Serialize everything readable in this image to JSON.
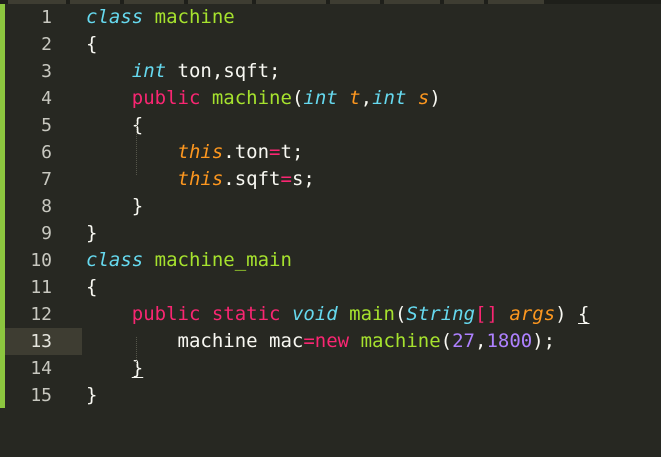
{
  "editor": {
    "lines": [
      {
        "num": "1",
        "tokens": [
          {
            "t": "class",
            "c": "st"
          },
          {
            "t": " "
          },
          {
            "t": "machine",
            "c": "fn"
          }
        ]
      },
      {
        "num": "2",
        "tokens": [
          {
            "t": "{"
          }
        ]
      },
      {
        "num": "3",
        "tokens": [
          {
            "t": "    "
          },
          {
            "t": "int",
            "c": "st"
          },
          {
            "t": " ton,sqft;"
          }
        ]
      },
      {
        "num": "4",
        "tokens": [
          {
            "t": "    "
          },
          {
            "t": "public",
            "c": "kw"
          },
          {
            "t": " "
          },
          {
            "t": "machine",
            "c": "fn"
          },
          {
            "t": "("
          },
          {
            "t": "int",
            "c": "st"
          },
          {
            "t": " "
          },
          {
            "t": "t",
            "c": "ar"
          },
          {
            "t": ","
          },
          {
            "t": "int",
            "c": "st"
          },
          {
            "t": " "
          },
          {
            "t": "s",
            "c": "ar"
          },
          {
            "t": ")"
          }
        ]
      },
      {
        "num": "5",
        "tokens": [
          {
            "t": "    {"
          }
        ]
      },
      {
        "num": "6",
        "tokens": [
          {
            "t": "        "
          },
          {
            "t": "this",
            "c": "ar"
          },
          {
            "t": ".ton"
          },
          {
            "t": "=",
            "c": "kw"
          },
          {
            "t": "t;"
          }
        ]
      },
      {
        "num": "7",
        "tokens": [
          {
            "t": "        "
          },
          {
            "t": "this",
            "c": "ar"
          },
          {
            "t": ".sqft"
          },
          {
            "t": "=",
            "c": "kw"
          },
          {
            "t": "s;"
          }
        ]
      },
      {
        "num": "8",
        "tokens": [
          {
            "t": "    }"
          }
        ]
      },
      {
        "num": "9",
        "tokens": [
          {
            "t": "}"
          }
        ]
      },
      {
        "num": "10",
        "tokens": [
          {
            "t": "class",
            "c": "st"
          },
          {
            "t": " "
          },
          {
            "t": "machine_main",
            "c": "fn"
          }
        ]
      },
      {
        "num": "11",
        "tokens": [
          {
            "t": "{"
          }
        ]
      },
      {
        "num": "12",
        "tokens": [
          {
            "t": "    "
          },
          {
            "t": "public",
            "c": "kw"
          },
          {
            "t": " "
          },
          {
            "t": "static",
            "c": "kw"
          },
          {
            "t": " "
          },
          {
            "t": "void",
            "c": "st"
          },
          {
            "t": " "
          },
          {
            "t": "main",
            "c": "fn"
          },
          {
            "t": "("
          },
          {
            "t": "String",
            "c": "st"
          },
          {
            "t": "[]",
            "c": "kw"
          },
          {
            "t": " "
          },
          {
            "t": "args",
            "c": "ar"
          },
          {
            "t": ") "
          },
          {
            "t": "{",
            "c": "ul"
          }
        ]
      },
      {
        "num": "13",
        "tokens": [
          {
            "t": "        machine mac"
          },
          {
            "t": "=",
            "c": "kw"
          },
          {
            "t": "new",
            "c": "kw"
          },
          {
            "t": " "
          },
          {
            "t": "machine",
            "c": "fn"
          },
          {
            "t": "("
          },
          {
            "t": "27",
            "c": "nm"
          },
          {
            "t": ","
          },
          {
            "t": "1800",
            "c": "nm"
          },
          {
            "t": ");"
          }
        ],
        "active": true
      },
      {
        "num": "14",
        "tokens": [
          {
            "t": "    "
          },
          {
            "t": "}",
            "c": "ul"
          }
        ]
      },
      {
        "num": "15",
        "tokens": [
          {
            "t": "}"
          }
        ]
      }
    ]
  },
  "colors": {
    "background": "#272822",
    "keyword": "#f92672",
    "storage": "#66d9ef",
    "function": "#a6e22e",
    "argument": "#fd971f",
    "number": "#ae81ff",
    "gutter_marker": "#8cc63f"
  }
}
